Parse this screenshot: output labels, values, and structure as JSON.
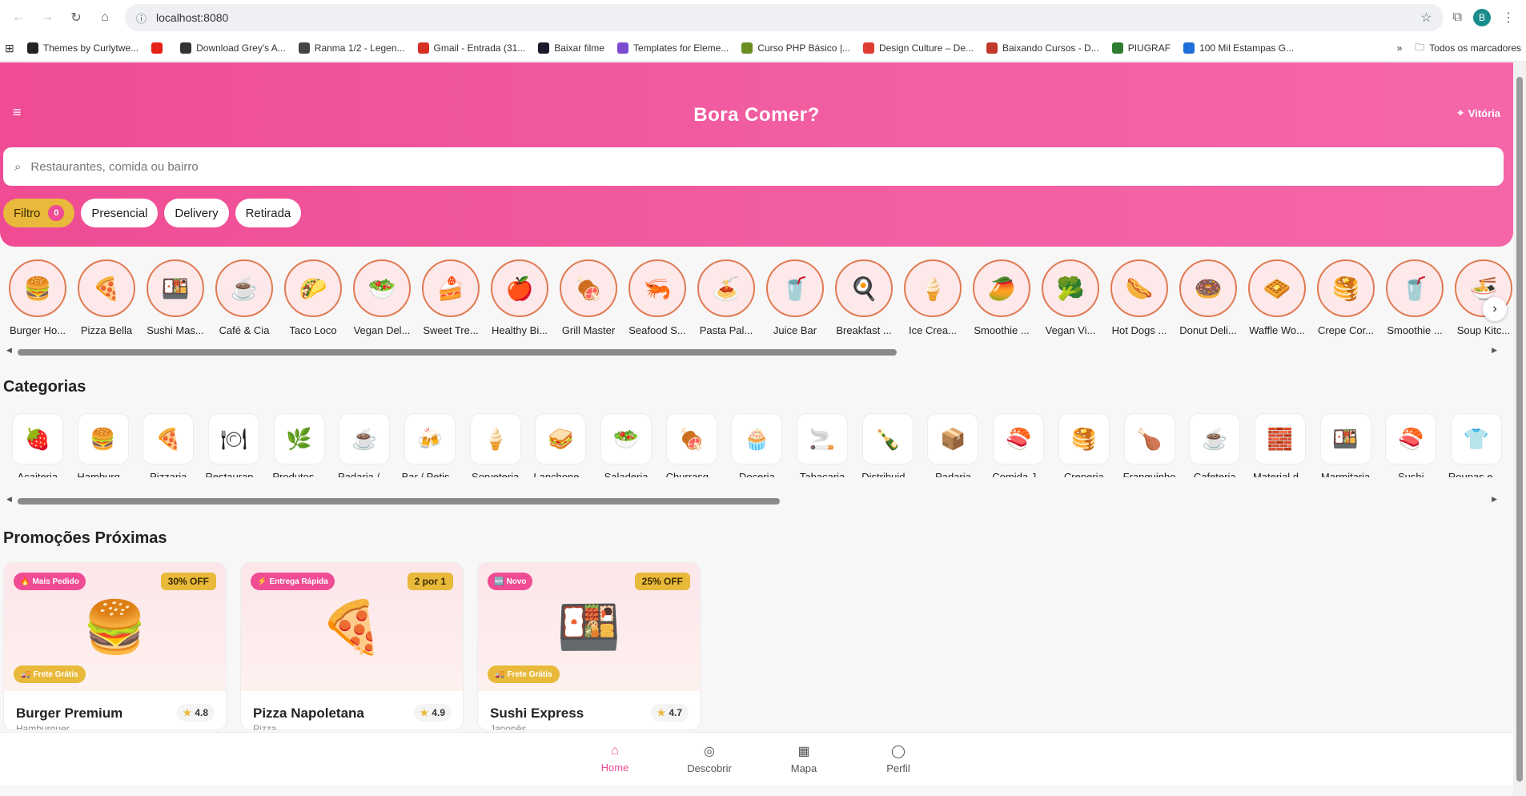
{
  "browser": {
    "url": "localhost:8080",
    "profile_initial": "B",
    "bookmarks": [
      {
        "label": "Themes by Curlytwe...",
        "color": "#222222"
      },
      {
        "label": "",
        "color": "#e62117"
      },
      {
        "label": "Download Grey's A...",
        "color": "#333333"
      },
      {
        "label": "Ranma 1/2 - Legen...",
        "color": "#444444"
      },
      {
        "label": "Gmail - Entrada (31...",
        "color": "#d93025"
      },
      {
        "label": "Baixar filme",
        "color": "#1a1a2e"
      },
      {
        "label": "Templates for Eleme...",
        "color": "#7b4bd1"
      },
      {
        "label": "Curso PHP Básico |...",
        "color": "#6b8e23"
      },
      {
        "label": "Design Culture – De...",
        "color": "#e03c31"
      },
      {
        "label": "Baixando Cursos - D...",
        "color": "#c0392b"
      },
      {
        "label": "PIUGRAF",
        "color": "#2e7d32"
      },
      {
        "label": "100 Mil Estampas G...",
        "color": "#1e6fd9"
      }
    ],
    "all_bookmarks": "Todos os marcadores"
  },
  "header": {
    "title": "Bora Comer?",
    "location": "Vitória",
    "search_placeholder": "Restaurantes, comida ou bairro"
  },
  "filters": {
    "filter_label": "Filtro",
    "filter_count": "0",
    "chips": [
      "Presencial",
      "Delivery",
      "Retirada"
    ]
  },
  "stores": [
    {
      "name": "Burger Ho...",
      "icon": "🍔"
    },
    {
      "name": "Pizza Bella",
      "icon": "🍕"
    },
    {
      "name": "Sushi Mas...",
      "icon": "🍱"
    },
    {
      "name": "Café & Cia",
      "icon": "☕"
    },
    {
      "name": "Taco Loco",
      "icon": "🌮"
    },
    {
      "name": "Vegan Del...",
      "icon": "🥗"
    },
    {
      "name": "Sweet Tre...",
      "icon": "🍰"
    },
    {
      "name": "Healthy Bi...",
      "icon": "🍎"
    },
    {
      "name": "Grill Master",
      "icon": "🍖"
    },
    {
      "name": "Seafood S...",
      "icon": "🦐"
    },
    {
      "name": "Pasta Pal...",
      "icon": "🍝"
    },
    {
      "name": "Juice Bar",
      "icon": "🥤"
    },
    {
      "name": "Breakfast ...",
      "icon": "🍳"
    },
    {
      "name": "Ice Crea...",
      "icon": "🍦"
    },
    {
      "name": "Smoothie ...",
      "icon": "🥭"
    },
    {
      "name": "Vegan Vi...",
      "icon": "🥦"
    },
    {
      "name": "Hot Dogs ...",
      "icon": "🌭"
    },
    {
      "name": "Donut Deli...",
      "icon": "🍩"
    },
    {
      "name": "Waffle Wo...",
      "icon": "🧇"
    },
    {
      "name": "Crepe Cor...",
      "icon": "🥞"
    },
    {
      "name": "Smoothie ...",
      "icon": "🥤"
    },
    {
      "name": "Soup Kitc...",
      "icon": "🍜"
    }
  ],
  "categories_title": "Categorias",
  "categories": [
    {
      "name": "Açaiteria",
      "icon": "🍓"
    },
    {
      "name": "Hamburg...",
      "icon": "🍔"
    },
    {
      "name": "Pizzaria",
      "icon": "🍕"
    },
    {
      "name": "Restauran...",
      "icon": "🍽"
    },
    {
      "name": "Produtos ...",
      "icon": "🌿"
    },
    {
      "name": "Padaria / ...",
      "icon": "☕"
    },
    {
      "name": "Bar / Petis...",
      "icon": "🍻"
    },
    {
      "name": "Sorveteria",
      "icon": "🍦"
    },
    {
      "name": "Lanchone...",
      "icon": "🥪"
    },
    {
      "name": "Saladeria",
      "icon": "🥗"
    },
    {
      "name": "Churrasq...",
      "icon": "🍖"
    },
    {
      "name": "Doceria",
      "icon": "🧁"
    },
    {
      "name": "Tabacaria",
      "icon": "🚬"
    },
    {
      "name": "Distribuid...",
      "icon": "🍾"
    },
    {
      "name": "Padaria",
      "icon": "📦"
    },
    {
      "name": "Comida J...",
      "icon": "🍣"
    },
    {
      "name": "Creperia",
      "icon": "🥞"
    },
    {
      "name": "Franguinho",
      "icon": "🍗"
    },
    {
      "name": "Cafeteria",
      "icon": "☕"
    },
    {
      "name": "Material d...",
      "icon": "🧱"
    },
    {
      "name": "Marmitaria",
      "icon": "🍱"
    },
    {
      "name": "Sushi",
      "icon": "🍣"
    },
    {
      "name": "Roupas e ...",
      "icon": "👕"
    }
  ],
  "promos_title": "Promoções Próximas",
  "promos": [
    {
      "tag": "Mais Pedido",
      "tag_icon": "🔥",
      "discount": "30% OFF",
      "shipping": "Frete Grátis",
      "image": "🍔",
      "title": "Burger Premium",
      "subtitle": "Hamburguer",
      "rating": "4.8"
    },
    {
      "tag": "Entrega Rápida",
      "tag_icon": "⚡",
      "discount": "2 por 1",
      "shipping": "",
      "image": "🍕",
      "title": "Pizza Napoletana",
      "subtitle": "Pizza",
      "rating": "4.9"
    },
    {
      "tag": "Novo",
      "tag_icon": "🆕",
      "discount": "25% OFF",
      "shipping": "Frete Grátis",
      "image": "🍱",
      "title": "Sushi Express",
      "subtitle": "Japonês",
      "rating": "4.7"
    }
  ],
  "bottom_nav": [
    {
      "label": "Home",
      "icon": "home-icon",
      "active": true
    },
    {
      "label": "Descobrir",
      "icon": "compass-icon",
      "active": false
    },
    {
      "label": "Mapa",
      "icon": "map-icon",
      "active": false
    },
    {
      "label": "Perfil",
      "icon": "user-icon",
      "active": false
    }
  ],
  "colors": {
    "accent": "#ef4c94",
    "gold": "#e8b93a"
  },
  "scroll": {
    "stores_visible_fraction": 0.6,
    "categories_visible_fraction": 0.52
  }
}
